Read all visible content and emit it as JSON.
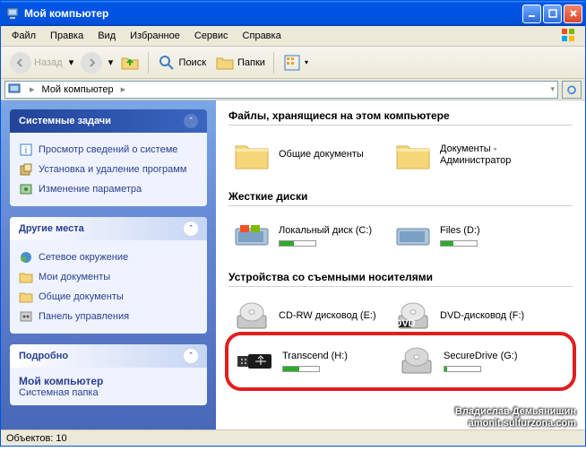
{
  "window": {
    "title": "Мой компьютер"
  },
  "menu": [
    "Файл",
    "Правка",
    "Вид",
    "Избранное",
    "Сервис",
    "Справка"
  ],
  "toolbar": {
    "back": "Назад",
    "search": "Поиск",
    "folders": "Папки"
  },
  "address": {
    "path": "Мой компьютер"
  },
  "sidebar": {
    "tasks": {
      "title": "Системные задачи",
      "items": [
        "Просмотр сведений о системе",
        "Установка и удаление программ",
        "Изменение параметра"
      ]
    },
    "places": {
      "title": "Другие места",
      "items": [
        "Сетевое окружение",
        "Мои документы",
        "Общие документы",
        "Панель управления"
      ]
    },
    "details": {
      "title": "Подробно",
      "name": "Мой компьютер",
      "type": "Системная папка"
    }
  },
  "content": {
    "sections": [
      {
        "title": "Файлы, хранящиеся на этом компьютере",
        "items": [
          {
            "label": "Общие документы",
            "icon": "folder"
          },
          {
            "label": "Документы - Администратор",
            "icon": "folder"
          }
        ]
      },
      {
        "title": "Жесткие диски",
        "items": [
          {
            "label": "Локальный диск (C:)",
            "icon": "hdd",
            "fill": 40
          },
          {
            "label": "Files (D:)",
            "icon": "hdd",
            "fill": 35
          }
        ]
      },
      {
        "title": "Устройства со съемными носителями",
        "items": [
          {
            "label": "CD-RW дисковод (E:)",
            "icon": "cd"
          },
          {
            "label": "DVD-дисковод (F:)",
            "icon": "dvd"
          }
        ],
        "highlighted": [
          {
            "label": "Transcend (H:)",
            "icon": "usb",
            "fill": 45
          },
          {
            "label": "SecureDrive (G:)",
            "icon": "removable-hdd",
            "fill": 8
          }
        ]
      }
    ]
  },
  "statusbar": {
    "text": "Объектов: 10"
  },
  "watermark": {
    "line1": "Владислав Демьянишин",
    "line2": "amonit.sulfurzona.com"
  }
}
